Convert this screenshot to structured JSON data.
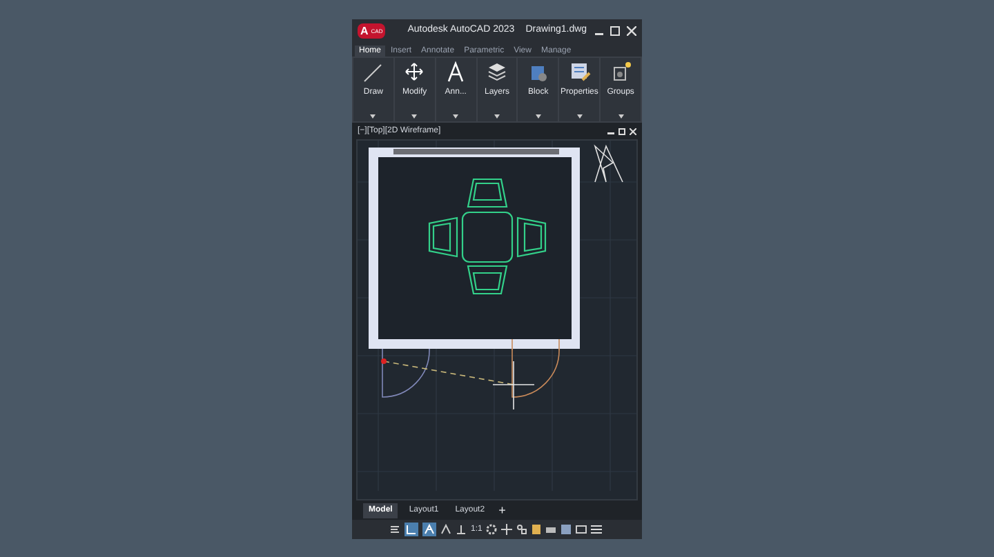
{
  "window": {
    "logo_letter": "A",
    "logo_badge": "CAD",
    "title": "Autodesk AutoCAD 2023",
    "file": "Drawing1.dwg"
  },
  "ribbon_tabs": [
    {
      "label": "Home",
      "selected": true
    },
    {
      "label": "Insert",
      "selected": false
    },
    {
      "label": "Annotate",
      "selected": false
    },
    {
      "label": "Parametric",
      "selected": false
    },
    {
      "label": "View",
      "selected": false
    },
    {
      "label": "Manage",
      "selected": false
    }
  ],
  "ribbon_panels": [
    {
      "kind": "draw",
      "label": "Draw"
    },
    {
      "kind": "modify",
      "label": "Modify"
    },
    {
      "kind": "annotate",
      "label": "Ann..."
    },
    {
      "kind": "layers",
      "label": "Layers"
    },
    {
      "kind": "block",
      "label": "Block"
    },
    {
      "kind": "properties",
      "label": "Properties"
    },
    {
      "kind": "groups",
      "label": "Groups"
    }
  ],
  "viewport": {
    "label": "[−][Top][2D Wireframe]"
  },
  "layout_tabs": [
    {
      "label": "Model",
      "selected": true
    },
    {
      "label": "Layout1",
      "selected": false
    },
    {
      "label": "Layout2",
      "selected": false
    }
  ],
  "add_tab": "+",
  "status_bar": {
    "scale": "1:1"
  }
}
